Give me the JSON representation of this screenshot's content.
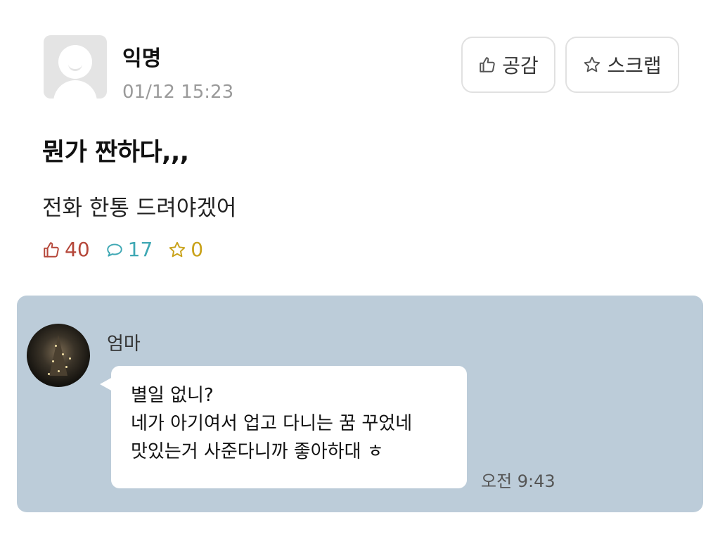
{
  "post": {
    "author": "익명",
    "timestamp": "01/12 15:23",
    "title": "뭔가 짠하다,,,",
    "content": "전화 한통 드려야겠어",
    "buttons": {
      "like_label": "공감",
      "scrap_label": "스크랩"
    },
    "stats": {
      "likes": "40",
      "comments": "17",
      "scraps": "0"
    }
  },
  "chat": {
    "sender": "엄마",
    "message_lines": [
      "별일 없니?",
      "네가 아기여서 업고 다니는 꿈 꾸었네",
      "맛있는거 사준다니까 좋아하대 ㅎ"
    ],
    "time": "오전 9:43"
  },
  "colors": {
    "likes": "#b5473a",
    "comments": "#3fa8b4",
    "scraps": "#c9a21a",
    "chat_background": "#bcccd9"
  },
  "icons": {
    "like": "thumbs-up-icon",
    "comment": "speech-bubble-icon",
    "scrap": "star-icon"
  }
}
